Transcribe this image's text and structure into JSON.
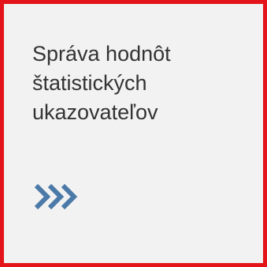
{
  "tile": {
    "title": "Správa hodnôt\nštatistických\nukazovateľov",
    "icon": "chevron-triple-right-icon",
    "icon_color": "#4b79a8",
    "border_color": "#e3151b",
    "background_color": "#f2f2f2"
  }
}
